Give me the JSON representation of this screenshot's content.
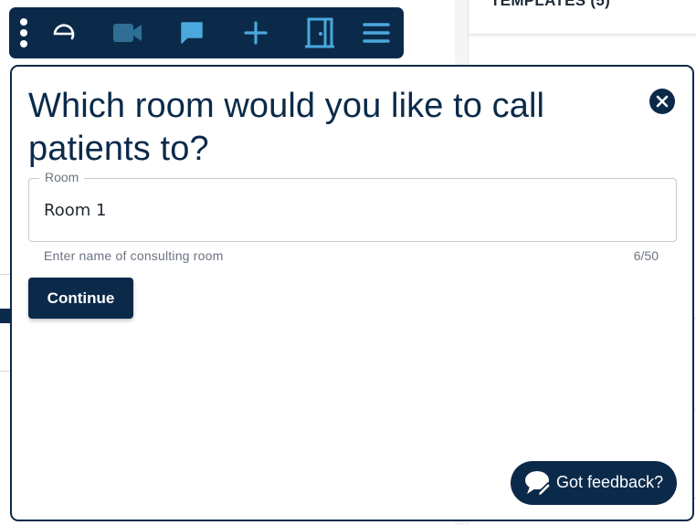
{
  "background": {
    "templates_heading": "TEMPLATES (5)"
  },
  "toolbar": {
    "items": [
      {
        "icon": "kebab-menu-icon"
      },
      {
        "icon": "app-logo-icon"
      },
      {
        "icon": "video-camera-icon"
      },
      {
        "icon": "chat-bubble-icon"
      },
      {
        "icon": "plus-icon"
      },
      {
        "icon": "door-icon"
      },
      {
        "icon": "hamburger-menu-icon"
      }
    ]
  },
  "dialog": {
    "title": "Which room would you like to call patients to?",
    "room_field": {
      "label": "Room",
      "value": "Room 1",
      "helper_text": "Enter name of consulting room",
      "counter": "6/50"
    },
    "continue_label": "Continue",
    "close_icon": "close-icon",
    "feedback_label": "Got feedback?"
  },
  "colors": {
    "navy": "#0b2a4a",
    "toolbar_icon_blue": "#4aa8dc",
    "video_icon_blue": "#2f6f96",
    "white": "#ffffff"
  }
}
